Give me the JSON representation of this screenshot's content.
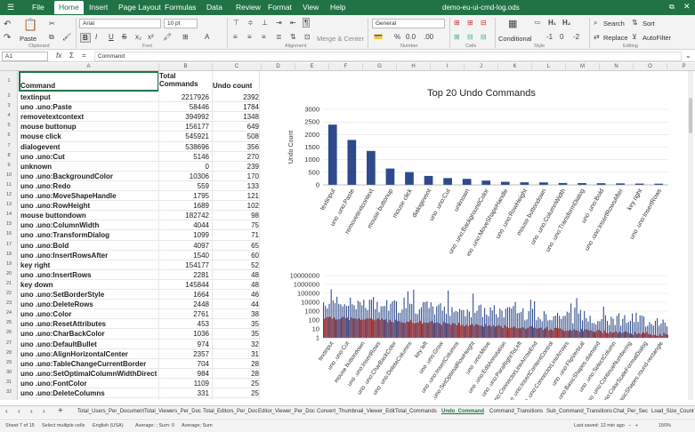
{
  "window": {
    "title": "demo-eu-ui-cmd-log.ods"
  },
  "menu": [
    "File",
    "Home",
    "Insert",
    "Page Layout",
    "Formulas",
    "Data",
    "Review",
    "Format",
    "View",
    "Help"
  ],
  "active_menu": "Home",
  "ribbon": {
    "paste": "Paste",
    "font_name": "Arial",
    "font_size": "10 pt",
    "number_format": "General",
    "merge_center": "Merge & Center",
    "conditional": "Conditional",
    "search": "Search",
    "replace": "Replace",
    "sort": "Sort",
    "autofilter": "AutoFilter",
    "groups": [
      "Clipboard",
      "Font",
      "Alignment",
      "Number",
      "Cells",
      "Style",
      "Editing"
    ]
  },
  "formula_bar": {
    "cell_ref": "A1",
    "content": "Command"
  },
  "columns": [
    "A",
    "B",
    "C",
    "D",
    "E",
    "F",
    "G",
    "H",
    "I",
    "J",
    "K",
    "L",
    "M",
    "N",
    "O",
    "P"
  ],
  "headers": {
    "command": "Command",
    "total_commands": "Total Commands",
    "undo_count": "Undo count"
  },
  "rows": [
    [
      "textinput",
      "2217926",
      "2392"
    ],
    [
      "uno .uno:Paste",
      "58446",
      "1784"
    ],
    [
      "removetextcontext",
      "394992",
      "1348"
    ],
    [
      "mouse buttonup",
      "156177",
      "649"
    ],
    [
      "mouse click",
      "545921",
      "508"
    ],
    [
      "dialogevent",
      "538696",
      "356"
    ],
    [
      "uno .uno:Cut",
      "5146",
      "270"
    ],
    [
      "unknown",
      "0",
      "239"
    ],
    [
      "uno .uno:BackgroundColor",
      "10306",
      "170"
    ],
    [
      "uno .uno:Redo",
      "559",
      "133"
    ],
    [
      "uno .uno:MoveShapeHandle",
      "1795",
      "121"
    ],
    [
      "uno .uno:RowHeight",
      "1689",
      "102"
    ],
    [
      "mouse buttondown",
      "182742",
      "98"
    ],
    [
      "uno .uno:ColumnWidth",
      "4044",
      "75"
    ],
    [
      "uno .uno:TransformDialog",
      "1099",
      "71"
    ],
    [
      "uno .uno:Bold",
      "4097",
      "65"
    ],
    [
      "uno .uno:InsertRowsAfter",
      "1540",
      "60"
    ],
    [
      "key right",
      "154177",
      "52"
    ],
    [
      "uno .uno:InsertRows",
      "2281",
      "48"
    ],
    [
      "key down",
      "145844",
      "48"
    ],
    [
      "uno .uno:SetBorderStyle",
      "1664",
      "46"
    ],
    [
      "uno .uno:DeleteRows",
      "2448",
      "44"
    ],
    [
      "uno .uno:Color",
      "2761",
      "38"
    ],
    [
      "uno .uno:ResetAttributes",
      "453",
      "35"
    ],
    [
      "uno .uno:CharBackColor",
      "1036",
      "35"
    ],
    [
      "uno .uno:DefaultBullet",
      "974",
      "32"
    ],
    [
      "uno .uno:AlignHorizontalCenter",
      "2357",
      "31"
    ],
    [
      "uno .uno:TableChangeCurrentBorder",
      "704",
      "28"
    ],
    [
      "uno .uno:SetOptimalColumnWidthDirect",
      "984",
      "28"
    ],
    [
      "uno .uno:FontColor",
      "1109",
      "25"
    ],
    [
      "uno .uno:DeleteColumns",
      "331",
      "25"
    ]
  ],
  "chart_data": [
    {
      "type": "bar",
      "title": "Top 20 Undo Commands",
      "ylabel": "Undo Count",
      "xlabel": "",
      "ylim": [
        0,
        3000
      ],
      "yticks": [
        "0",
        "500",
        "1000",
        "1500",
        "2000",
        "2500",
        "3000"
      ],
      "color": "#2e4a8c",
      "categories": [
        "textinput",
        "uno .uno:Paste",
        "removetextcontext",
        "mouse buttonup",
        "mouse click",
        "dialogevent",
        "uno .uno:Cut",
        "unknown",
        "uno .uno:BackgroundColor",
        "uno .uno:MoveShapeHandle",
        "uno .uno:RowHeight",
        "mouse buttondown",
        "uno .uno:ColumnWidth",
        "uno .uno:TransformDialog",
        "uno .uno:Bold",
        "uno .uno:InsertRowsAfter",
        "key right",
        "uno .uno:InsertRows"
      ],
      "values": [
        2392,
        1784,
        1348,
        649,
        508,
        356,
        270,
        239,
        170,
        121,
        102,
        98,
        75,
        71,
        65,
        60,
        52,
        48
      ]
    },
    {
      "type": "bar",
      "title": "",
      "scale": "log",
      "yticks": [
        "1",
        "10",
        "100",
        "1000",
        "10000",
        "100000",
        "1000000",
        "10000000"
      ],
      "series": [
        {
          "name": "Total Commands",
          "color": "#2e4a8c"
        },
        {
          "name": "Undo count",
          "color": "#c0392b"
        }
      ],
      "categories": [
        "textinput",
        "uno .uno:Cut",
        "mouse buttondown",
        "uno .uno:InsertRows",
        "uno .uno:CharBackColor",
        "uno .uno:DeleteColumns",
        "key left",
        "uno .uno:Grow",
        "uno .uno:InsertColumns",
        "uno .uno:SetOptimalRowHeight",
        "uno .uno:Move",
        "uno .uno:EditAnnotation",
        "uno .uno:ParaRightToLeft",
        "uno .uno:ConnectorLineArrowEnd",
        "uno .uno:InsertContentControl",
        "uno .uno:ConnectorLineArrows",
        "uno .uno:FlipVertical",
        "uno .uno:BasicShapes.diamond",
        "uno .uno:SelectColumn",
        "uno .uno:ContinueNumbering",
        "uno .uno:ColorScaleFormatDialog",
        "uno .uno:BasicShapes.round-rectangle"
      ]
    }
  ],
  "sheet_tabs": [
    "Total_Users_Per_Document",
    "Total_Viewers_Per_Doc",
    "Total_Editors_Per_Doc",
    "Editor_Viewer_Per_Doc",
    "Convert_Thumbnail_Viewer_Edit",
    "Total_Commands",
    "Undo_Command",
    "Command_Transitions",
    "Sub_Command_Transitions",
    "Chat_Per_Sec",
    "Load_Size_Count"
  ],
  "active_tab": "Undo_Command",
  "status": {
    "sheet": "Sheet 7 of 15",
    "selection": "Select multiple cells",
    "language": "English (USA)",
    "average": "Average: ; Sum: 0",
    "func": "Average; Sum",
    "saved": "Last saved: 12 min ago",
    "zoom": "150%"
  }
}
